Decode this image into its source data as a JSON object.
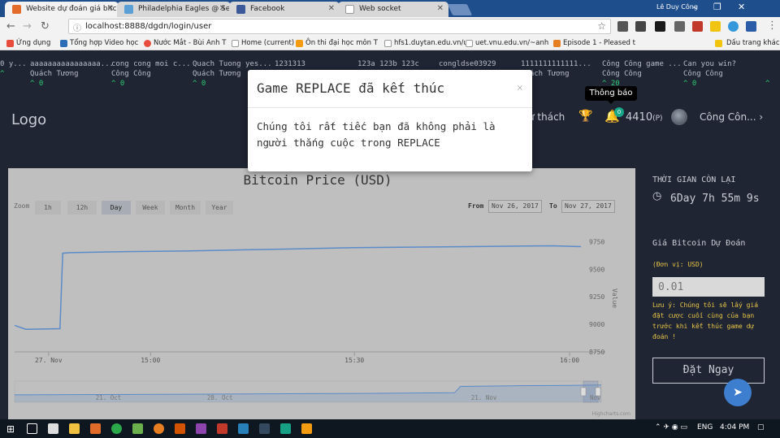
{
  "browser": {
    "tabs": [
      {
        "title": "Website dự đoán giá bitc",
        "active": true
      },
      {
        "title": "Philadelphia Eagles @ Se",
        "active": false
      },
      {
        "title": "Facebook",
        "active": false
      },
      {
        "title": "Web socket",
        "active": false
      }
    ],
    "profile_name": "Lê Duy Công",
    "url": "localhost:8888/dgdn/login/user",
    "bookmarks": [
      "Ứng dụng",
      "Tổng hợp Video học",
      "Nước Mắt - Bùi Anh T",
      "Home (current)",
      "Ôn thi đại học môn T",
      "hfs1.duytan.edu.vn/u",
      "uet.vnu.edu.vn/~anh",
      "Episode 1 - Pleased t"
    ],
    "bookmarks_other": "Dấu trang khác"
  },
  "ticker": [
    {
      "title": "0 y...",
      "user": "",
      "count": "^"
    },
    {
      "title": "aaaaaaaaaaaaaaaa...",
      "user": "Quách Tương",
      "count": "^ 0"
    },
    {
      "title": "cong cong moi c...",
      "user": "Công Công",
      "count": "^ 0"
    },
    {
      "title": "Quach Tuong yes...",
      "user": "Quách Tương",
      "count": "^ 0"
    },
    {
      "title": "1231313",
      "user": "",
      "count": ""
    },
    {
      "title": "123a 123b 123c",
      "user": "",
      "count": ""
    },
    {
      "title": "congldse03929",
      "user": "",
      "count": ""
    },
    {
      "title": "1111111111111...",
      "user": "Quách Tương",
      "count": ""
    },
    {
      "title": "Công Công game ...",
      "user": "Công Công",
      "count": "^ 20"
    },
    {
      "title": "Can you win?",
      "user": "Công Công",
      "count": "^ 0"
    },
    {
      "title": "",
      "user": "",
      "count": "^"
    }
  ],
  "nav": {
    "logo": "Logo",
    "challenge": "ử thách",
    "tooltip": "Thông báo",
    "notif_count": "0",
    "points": "4410",
    "points_unit": "(P)",
    "username": "Công Côn..."
  },
  "modal": {
    "title": "Game REPLACE đã kết thúc",
    "close": "×",
    "body": "Chúng tôi rất tiếc bạn đã không phải là người thắng cuộc trong REPLACE"
  },
  "chart_controls": {
    "zoom_label": "Zoom",
    "buttons": [
      "1h",
      "12h",
      "Day",
      "Week",
      "Month",
      "Year"
    ],
    "selected": "Day",
    "from_label": "From",
    "from_value": "Nov 26, 2017",
    "to_label": "To",
    "to_value": "Nov 27, 2017",
    "credit": "Highcharts.com"
  },
  "chart_data": {
    "type": "line",
    "title": "Bitcoin Price (USD)",
    "ylabel": "Value",
    "ylim": [
      8750,
      9900
    ],
    "yticks": [
      8750,
      9000,
      9250,
      9500,
      9750
    ],
    "xticks": [
      "27. Nov",
      "15:00",
      "15:30",
      "16:00"
    ],
    "x": [
      0,
      0.02,
      0.08,
      0.085,
      0.1,
      0.2,
      0.3,
      0.4,
      0.5,
      0.6,
      0.7,
      0.8,
      0.9,
      0.95,
      1.0
    ],
    "series": [
      {
        "name": "",
        "values": [
          8990,
          8955,
          8960,
          9645,
          9650,
          9660,
          9665,
          9675,
          9685,
          9695,
          9700,
          9705,
          9710,
          9712,
          9705
        ]
      }
    ],
    "navigator": {
      "xticks": [
        "21. Oct",
        "28. Oct",
        "21. Nov",
        "Nov"
      ],
      "x": [
        0,
        0.3,
        0.6,
        0.75,
        0.76,
        0.85,
        0.95,
        1.0
      ],
      "values": [
        0.35,
        0.38,
        0.42,
        0.45,
        0.75,
        0.78,
        0.8,
        0.82
      ]
    },
    "grid": false,
    "legend": "none"
  },
  "right_panel": {
    "time_left_label": "THỜI GIAN CÒN LẠI",
    "countdown": "6Day 7h 55m 9s",
    "predict_label": "Giá Bitcoin Dự Đoán",
    "unit": "(Đơn vị: USD)",
    "input_placeholder": "0.01",
    "note": "Lưu ý: Chúng tôi sẽ lấy giá đặt cược cuối cùng của bạn trước khi kết thúc game dự đoán !",
    "bet_button": "Đặt Ngay"
  },
  "taskbar": {
    "lang": "ENG",
    "time": "4:04 PM"
  }
}
